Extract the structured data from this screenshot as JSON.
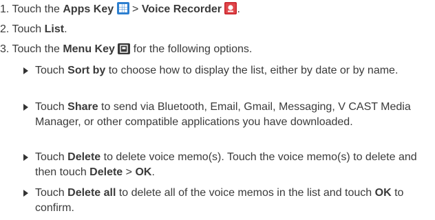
{
  "steps": [
    {
      "num": "1.",
      "pre": "Touch the ",
      "bold1": "Apps Key",
      "sep": " > ",
      "bold2": "Voice Recorder",
      "end": "."
    },
    {
      "num": "2.",
      "pre": "Touch ",
      "bold": "List",
      "end": "."
    },
    {
      "num": "3.",
      "pre": "Touch the ",
      "bold": "Menu Key",
      "post": " for the following options."
    }
  ],
  "bullets": [
    {
      "segments": [
        {
          "text": "Touch ",
          "bold": false
        },
        {
          "text": "Sort by",
          "bold": true
        },
        {
          "text": " to choose how to display the list, either by date or by name.",
          "bold": false
        }
      ]
    },
    {
      "segments": [
        {
          "text": "Touch ",
          "bold": false
        },
        {
          "text": "Share",
          "bold": true
        },
        {
          "text": " to send via Bluetooth, Email, Gmail, Messaging, V CAST Media Manager, or other compatible applications you have downloaded.",
          "bold": false
        }
      ]
    },
    {
      "segments": [
        {
          "text": "Touch ",
          "bold": false
        },
        {
          "text": "Delete",
          "bold": true
        },
        {
          "text": " to delete voice memo(s). Touch the voice memo(s) to delete and then touch ",
          "bold": false
        },
        {
          "text": "Delete",
          "bold": true
        },
        {
          "text": " > ",
          "bold": false
        },
        {
          "text": "OK",
          "bold": true
        },
        {
          "text": ".",
          "bold": false
        }
      ]
    },
    {
      "segments": [
        {
          "text": "Touch ",
          "bold": false
        },
        {
          "text": "Delete all",
          "bold": true
        },
        {
          "text": " to delete all of the voice memos in the list and touch ",
          "bold": false
        },
        {
          "text": "OK",
          "bold": true
        },
        {
          "text": " to confirm.",
          "bold": false
        }
      ]
    }
  ],
  "icons": {
    "apps_key": "apps-key-icon",
    "voice_recorder": "voice-recorder-icon",
    "menu_key": "menu-key-icon"
  },
  "colors": {
    "text": "#3a3a3a",
    "apps_key_blue": "#2d7fd0",
    "recorder_red": "#c8242c",
    "menu_key_gray": "#3a3a3a"
  }
}
